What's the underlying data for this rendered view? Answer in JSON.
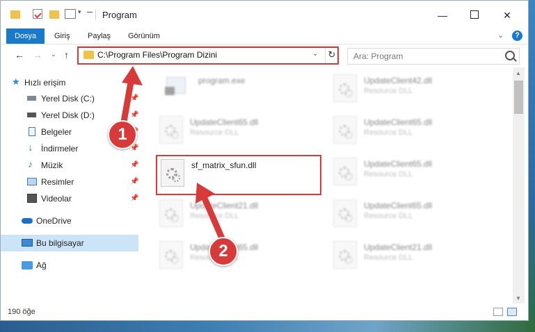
{
  "window": {
    "title": "Program"
  },
  "ribbon": {
    "tabs": [
      "Dosya",
      "Giriş",
      "Paylaş",
      "Görünüm"
    ]
  },
  "address": {
    "path": "C:\\Program Files\\Program Dizini"
  },
  "search": {
    "placeholder": "Ara: Program"
  },
  "sidebar": {
    "items": [
      {
        "label": "Hızlı erişim",
        "icon": "star-icon"
      },
      {
        "label": "Yerel Disk (C:)",
        "icon": "drive-icon"
      },
      {
        "label": "Yerel Disk (D:)",
        "icon": "drive-icon"
      },
      {
        "label": "Belgeler",
        "icon": "documents-icon"
      },
      {
        "label": "İndirmeler",
        "icon": "download-icon"
      },
      {
        "label": "Müzik",
        "icon": "music-icon"
      },
      {
        "label": "Resimler",
        "icon": "pictures-icon"
      },
      {
        "label": "Videolar",
        "icon": "video-icon"
      },
      {
        "label": "OneDrive",
        "icon": "cloud-icon"
      },
      {
        "label": "Bu bilgisayar",
        "icon": "computer-icon"
      },
      {
        "label": "Ağ",
        "icon": "network-icon"
      }
    ]
  },
  "files": [
    {
      "name": "program.exe",
      "type": ""
    },
    {
      "name": "UpdateClient42.dll",
      "type": "Resource DLL"
    },
    {
      "name": "UpdateClient65.dll",
      "type": "Resource DLL"
    },
    {
      "name": "UpdateClient65.dll",
      "type": "Resource DLL"
    },
    {
      "name": "sf_matrix_sfun.dll",
      "type": ""
    },
    {
      "name": "UpdateClient65.dll",
      "type": "Resource DLL"
    },
    {
      "name": "UpdateClient21.dll",
      "type": "Resource DLL"
    },
    {
      "name": "UpdateClient65.dll",
      "type": "Resource DLL"
    },
    {
      "name": "UpdateClient65.dll",
      "type": "Resource DLL"
    },
    {
      "name": "UpdateClient21.dll",
      "type": "Resource DLL"
    }
  ],
  "status": {
    "count": "190 öğe"
  },
  "annotations": {
    "step1": "1",
    "step2": "2"
  },
  "colors": {
    "accent": "#1979ca",
    "highlight": "#d83a3a",
    "folder": "#f0c24a"
  }
}
